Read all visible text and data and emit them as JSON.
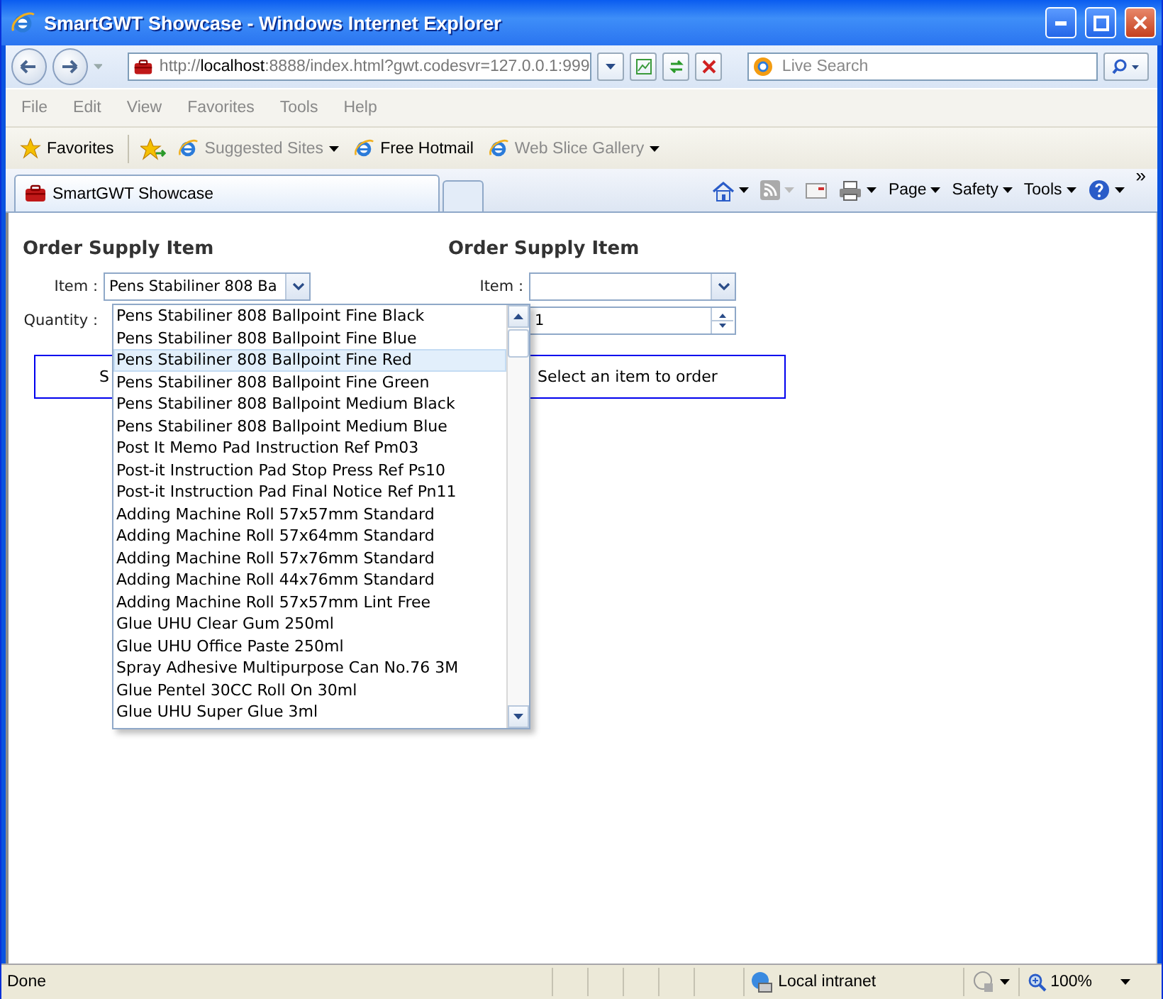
{
  "window": {
    "title": "SmartGWT Showcase - Windows Internet Explorer"
  },
  "address_bar": {
    "scheme": "http://",
    "host": "localhost",
    "rest": ":8888/index.html?gwt.codesvr=127.0.0.1:999"
  },
  "search": {
    "placeholder": "Live Search"
  },
  "menu": [
    "File",
    "Edit",
    "View",
    "Favorites",
    "Tools",
    "Help"
  ],
  "favorites_bar": [
    {
      "label": "Favorites",
      "kind": "star",
      "disabled": false,
      "dropdown": false
    },
    {
      "label": "Suggested Sites",
      "kind": "page",
      "disabled": true,
      "dropdown": true
    },
    {
      "label": "Free Hotmail",
      "kind": "page",
      "disabled": false,
      "dropdown": false
    },
    {
      "label": "Web Slice Gallery",
      "kind": "page",
      "disabled": true,
      "dropdown": true
    }
  ],
  "tabs": [
    {
      "label": "SmartGWT Showcase",
      "selected": true
    }
  ],
  "command_bar": [
    "Page",
    "Safety",
    "Tools"
  ],
  "overflow_chevron": "»",
  "forms": [
    {
      "heading": "Order Supply Item",
      "item_label": "Item :",
      "item_value": "Pens Stabiliner 808 Ba",
      "quantity_label": "Quantity :",
      "message": "S"
    },
    {
      "heading": "Order Supply Item",
      "item_label": "Item :",
      "quantity_value": "1",
      "message": "Select an item to order"
    }
  ],
  "dropdown": {
    "items": [
      {
        "label": "Pens Stabiliner 808 Ballpoint Fine Black",
        "selected": false
      },
      {
        "label": "Pens Stabiliner 808 Ballpoint Fine Blue",
        "selected": false
      },
      {
        "label": "Pens Stabiliner 808 Ballpoint Fine Red",
        "selected": true
      },
      {
        "label": "Pens Stabiliner 808 Ballpoint Fine Green",
        "selected": false
      },
      {
        "label": "Pens Stabiliner 808 Ballpoint Medium Black",
        "selected": false
      },
      {
        "label": "Pens Stabiliner 808 Ballpoint Medium Blue",
        "selected": false
      },
      {
        "label": "Post It Memo Pad Instruction Ref Pm03",
        "selected": false
      },
      {
        "label": "Post-it Instruction Pad Stop Press Ref Ps10",
        "selected": false
      },
      {
        "label": "Post-it Instruction Pad Final Notice Ref Pn11",
        "selected": false
      },
      {
        "label": "Adding Machine Roll 57x57mm Standard",
        "selected": false
      },
      {
        "label": "Adding Machine Roll 57x64mm Standard",
        "selected": false
      },
      {
        "label": "Adding Machine Roll 57x76mm Standard",
        "selected": false
      },
      {
        "label": "Adding Machine Roll 44x76mm Standard",
        "selected": false
      },
      {
        "label": "Adding Machine Roll 57x57mm Lint Free",
        "selected": false
      },
      {
        "label": "Glue UHU Clear Gum 250ml",
        "selected": false
      },
      {
        "label": "Glue UHU Office Paste 250ml",
        "selected": false
      },
      {
        "label": "Spray Adhesive Multipurpose Can No.76 3M",
        "selected": false
      },
      {
        "label": "Glue Pentel 30CC Roll On 30ml",
        "selected": false
      },
      {
        "label": "Glue UHU Super Glue 3ml",
        "selected": false
      }
    ]
  },
  "status_bar": {
    "text": "Done",
    "zone": "Local intranet",
    "zoom": "100%"
  }
}
